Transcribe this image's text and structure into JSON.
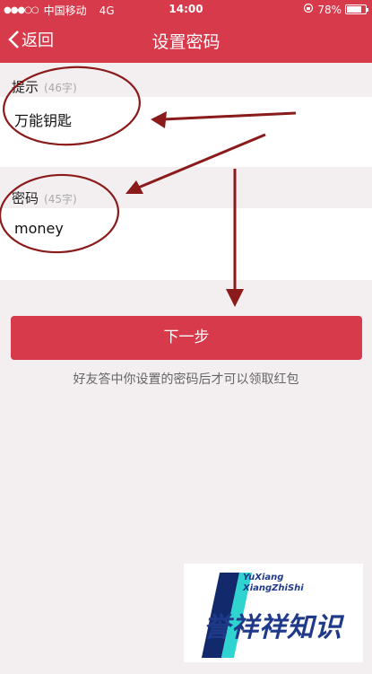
{
  "status_bar": {
    "signal_dots": "●●●○○",
    "carrier": "中国移动",
    "network": "4G",
    "time": "14:00",
    "battery": "78%",
    "battery_level": 0.78
  },
  "nav": {
    "back_label": "返回",
    "title": "设置密码"
  },
  "hint_section": {
    "label": "提示",
    "count": "(46字)",
    "value": "万能钥匙"
  },
  "password_section": {
    "label": "密码",
    "count": "(45字)",
    "value": "money"
  },
  "next_button": {
    "label": "下一步"
  },
  "footer_hint": "好友答中你设置的密码后才可以领取红包",
  "watermark": {
    "line1": "YuXiang",
    "line2": "XiangZhiShi",
    "main": "誉祥祥知识"
  },
  "colors": {
    "accent": "#d63a4b",
    "annotation": "#8b1a1a",
    "background": "#f3eef0"
  }
}
